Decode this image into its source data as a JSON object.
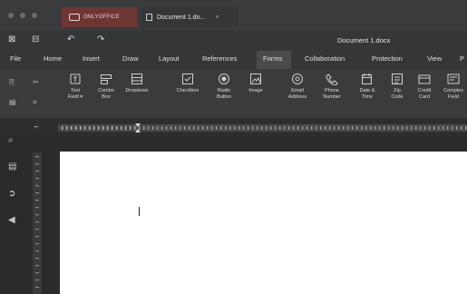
{
  "window": {
    "brand_tab_label": "ONLYOFFICE",
    "doc_tab_label": "Document 1.do...",
    "doc_tab_close": "×",
    "document_title": "Document 1.docx"
  },
  "menu": {
    "items": [
      "File",
      "Home",
      "Insert",
      "Draw",
      "Layout",
      "References",
      "Forms",
      "Collaboration",
      "Protection",
      "View",
      "P"
    ],
    "active": "Forms"
  },
  "ribbon": {
    "buttons": [
      {
        "label": "Text\nField ▾",
        "icon": "text-field-icon"
      },
      {
        "label": "Combo\nBox",
        "icon": "combo-box-icon"
      },
      {
        "label": "Dropdown",
        "icon": "dropdown-icon"
      },
      {
        "label": "Checkbox",
        "icon": "checkbox-icon"
      },
      {
        "label": "Radio\nButton",
        "icon": "radio-button-icon"
      },
      {
        "label": "Image",
        "icon": "image-icon"
      },
      {
        "label": "Email\nAddress",
        "icon": "email-icon"
      },
      {
        "label": "Phone\nNumber",
        "icon": "phone-icon"
      },
      {
        "label": "Date &\nTime",
        "icon": "calendar-icon"
      },
      {
        "label": "Zip\nCode",
        "icon": "zip-code-icon"
      },
      {
        "label": "Credit\nCard",
        "icon": "credit-card-icon"
      },
      {
        "label": "Complex\nField",
        "icon": "complex-field-icon"
      }
    ]
  },
  "colors": {
    "brand_tab": "#6d3533",
    "chrome": "#353638",
    "ribbon": "#3a3b3d",
    "page": "#ffffff"
  }
}
